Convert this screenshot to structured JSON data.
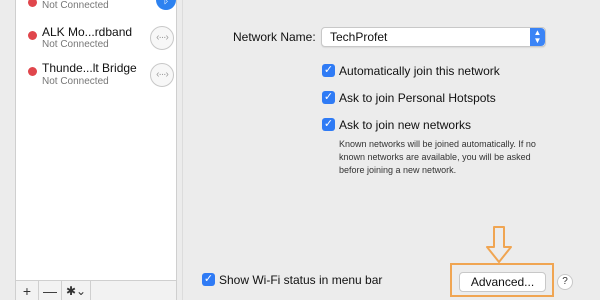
{
  "sidebar": {
    "items": [
      {
        "name": "",
        "status": "Not Connected",
        "icon": "bluetooth-icon"
      },
      {
        "name": "ALK Mo...rdband",
        "status": "Not Connected",
        "icon": "ethernet-arrows-icon"
      },
      {
        "name": "Thunde...lt Bridge",
        "status": "Not Connected",
        "icon": "ethernet-arrows-icon"
      }
    ],
    "footer": {
      "add": "+",
      "remove": "—",
      "gear": "✱⌄"
    }
  },
  "panel": {
    "network_name_label": "Network Name:",
    "network_name_value": "TechProfet",
    "checkboxes": [
      {
        "label": "Automatically join this network",
        "checked": true
      },
      {
        "label": "Ask to join Personal Hotspots",
        "checked": true
      },
      {
        "label": "Ask to join new networks",
        "checked": true
      }
    ],
    "help_text": "Known networks will be joined automatically. If no known networks are available, you will be asked before joining a new network.",
    "show_status_label": "Show Wi-Fi status in menu bar",
    "advanced_label": "Advanced...",
    "help_glyph": "?"
  },
  "colors": {
    "accent": "#2f7bf5",
    "status_red": "#e0464c",
    "highlight": "#f0a552"
  }
}
